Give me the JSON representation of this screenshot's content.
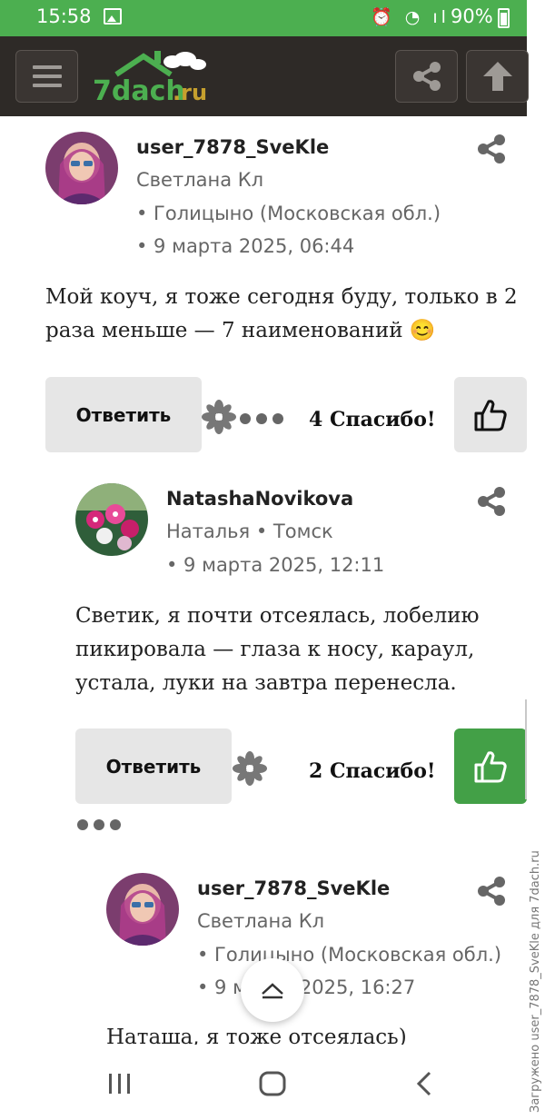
{
  "status": {
    "time": "15:58",
    "battery": "90%",
    "sicons": "⏰ ◔ ıl"
  },
  "site": {
    "logo_text": "7dach.ru"
  },
  "comments": [
    {
      "user": "user_7878_SveKle",
      "name": "Светлана Кл",
      "location": "• Голицыно (Московская обл.)",
      "date": "•  9 марта 2025, 06:44",
      "text": "Мой коуч, я тоже сегодня буду, только в 2 раза меньше — 7 наименований 😊",
      "reply_label": "Ответить",
      "thanks": "4 Спасибо!"
    },
    {
      "user": "NatashaNovikova",
      "name_loc": "Наталья • Томск",
      "date": "•  9 марта 2025, 12:11",
      "text": "Светик, я почти отсеялась, лобелию пикировала — глаза к носу, караул, устала, луки на завтра перенесла.",
      "reply_label": "Ответить",
      "thanks": "2 Спасибо!"
    },
    {
      "user": "user_7878_SveKle",
      "name": "Светлана Кл",
      "location": "• Голицыно (Московская обл.)",
      "date": "•  9 марта 2025, 16:27",
      "text": "Наташа, я тоже отсеялась)"
    }
  ],
  "watermark": "Загружено user_7878_SveKle для 7dach.ru",
  "colors": {
    "status_green": "#4caf50",
    "appbar": "#2e2a27",
    "like_green": "#43a047"
  }
}
